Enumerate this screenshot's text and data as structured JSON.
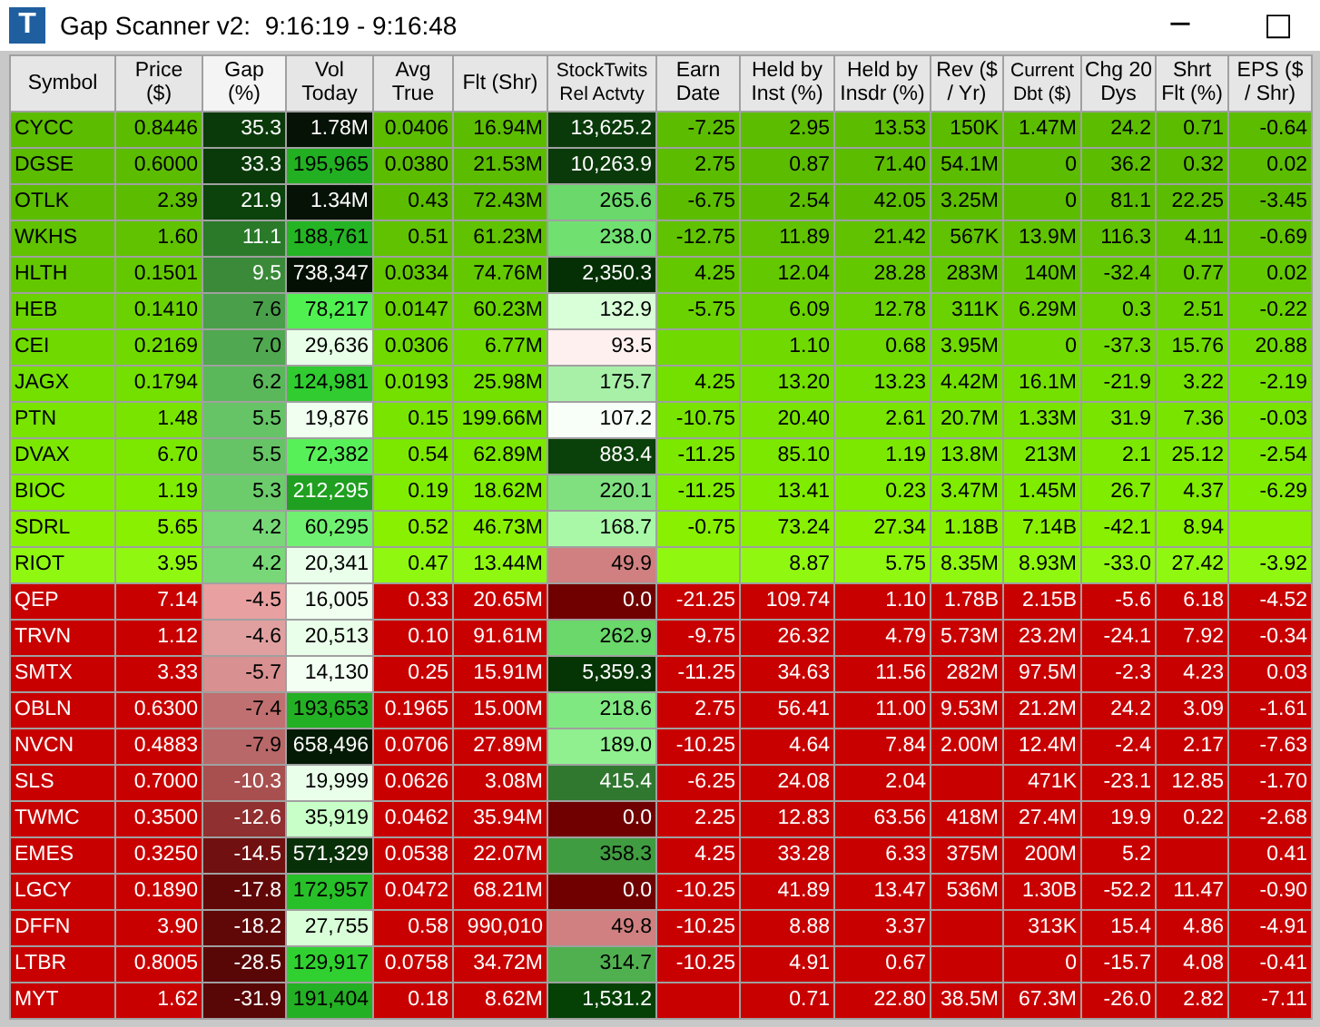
{
  "window": {
    "icon_letter": "T",
    "title": "Gap Scanner v2:  9:16:19 - 9:16:48",
    "controls": [
      "─",
      "□"
    ]
  },
  "table": {
    "columns": [
      {
        "label": "Symbol",
        "selected": false
      },
      {
        "label": "Price\n($)",
        "selected": false
      },
      {
        "label": "Gap\n(%)",
        "selected": true
      },
      {
        "label": "Vol\nToday",
        "selected": false
      },
      {
        "label": "Avg\nTrue",
        "selected": false
      },
      {
        "label": "Flt (Shr)",
        "selected": false
      },
      {
        "label": "StockTwits\nRel Actvty",
        "selected": false
      },
      {
        "label": "Earn\nDate",
        "selected": false
      },
      {
        "label": "Held by\nInst (%)",
        "selected": false
      },
      {
        "label": "Held by\nInsdr (%)",
        "selected": false
      },
      {
        "label": "Rev ($\n/ Yr)",
        "selected": false
      },
      {
        "label": "Current\nDbt ($)",
        "selected": false
      },
      {
        "label": "Chg 20\nDys",
        "selected": false
      },
      {
        "label": "Shrt\nFlt (%)",
        "selected": false
      },
      {
        "label": "EPS ($\n/ Shr)",
        "selected": false
      }
    ],
    "rows": [
      {
        "color": "#5cbc00",
        "cells": [
          "CYCC",
          "0.8446",
          {
            "text": "35.3",
            "color": "#0a3a0a"
          },
          {
            "text": "1.78M",
            "color": "#061206"
          },
          "0.0406",
          "16.94M",
          {
            "text": "13,625.2",
            "color": "#0a3a0a"
          },
          "-7.25",
          "2.95",
          "13.53",
          "150K",
          "1.47M",
          "24.2",
          "0.71",
          "-0.64"
        ]
      },
      {
        "color": "#5cbc00",
        "cells": [
          "DGSE",
          "0.6000",
          {
            "text": "33.3",
            "color": "#0a3a0a"
          },
          {
            "text": "195,965",
            "color": "#22b022"
          },
          "0.0380",
          "21.53M",
          {
            "text": "10,263.9",
            "color": "#0a3a0a"
          },
          "2.75",
          "0.87",
          "71.40",
          "54.1M",
          "0",
          "36.2",
          "0.32",
          "0.02"
        ]
      },
      {
        "color": "#5cbc00",
        "cells": [
          "OTLK",
          "2.39",
          {
            "text": "21.9",
            "color": "#0c420c"
          },
          {
            "text": "1.34M",
            "color": "#061206"
          },
          "0.43",
          "72.43M",
          {
            "text": "265.6",
            "color": "#6ad86a"
          },
          "-6.75",
          "2.54",
          "42.05",
          "3.25M",
          "0",
          "81.1",
          "22.25",
          "-3.45"
        ]
      },
      {
        "color": "#60c200",
        "cells": [
          "WKHS",
          "1.60",
          {
            "text": "11.1",
            "color": "#2a7a2a"
          },
          {
            "text": "188,761",
            "color": "#24b424"
          },
          "0.51",
          "61.23M",
          {
            "text": "238.0",
            "color": "#70e070"
          },
          "-12.75",
          "11.89",
          "21.42",
          "567K",
          "13.9M",
          "116.3",
          "4.11",
          "-0.69"
        ]
      },
      {
        "color": "#64c800",
        "cells": [
          "HLTH",
          "0.1501",
          {
            "text": "9.5",
            "color": "#3a8a3a"
          },
          {
            "text": "738,347",
            "color": "#051005"
          },
          "0.0334",
          "74.76M",
          {
            "text": "2,350.3",
            "color": "#053005"
          },
          "4.25",
          "12.04",
          "28.28",
          "283M",
          "140M",
          "-32.4",
          "0.77",
          "0.02"
        ]
      },
      {
        "color": "#6ad200",
        "cells": [
          "HEB",
          "0.1410",
          {
            "text": "7.6",
            "color": "#4aa04a"
          },
          {
            "text": "78,217",
            "color": "#50f050"
          },
          "0.0147",
          "60.23M",
          {
            "text": "132.9",
            "color": "#d8ffd8"
          },
          "-5.75",
          "6.09",
          "12.78",
          "311K",
          "6.29M",
          "0.3",
          "2.51",
          "-0.22"
        ]
      },
      {
        "color": "#70da00",
        "cells": [
          "CEI",
          "0.2169",
          {
            "text": "7.0",
            "color": "#50a850"
          },
          {
            "text": "29,636",
            "color": "#e8ffe8"
          },
          "0.0306",
          "6.77M",
          {
            "text": "93.5",
            "color": "#fff0f0"
          },
          null,
          "1.10",
          "0.68",
          "3.95M",
          "0",
          "-37.3",
          "15.76",
          "20.88"
        ]
      },
      {
        "color": "#74e000",
        "cells": [
          "JAGX",
          "0.1794",
          {
            "text": "6.2",
            "color": "#5ab85a"
          },
          {
            "text": "124,981",
            "color": "#30cc30"
          },
          "0.0193",
          "25.98M",
          {
            "text": "175.7",
            "color": "#a8f0a8"
          },
          "4.25",
          "13.20",
          "13.23",
          "4.42M",
          "16.1M",
          "-21.9",
          "3.22",
          "-2.19"
        ]
      },
      {
        "color": "#78e400",
        "cells": [
          "PTN",
          "1.48",
          {
            "text": "5.5",
            "color": "#66c466"
          },
          {
            "text": "19,876",
            "color": "#f0fff0"
          },
          "0.15",
          "199.66M",
          {
            "text": "107.2",
            "color": "#f8fff8"
          },
          "-10.75",
          "20.40",
          "2.61",
          "20.7M",
          "1.33M",
          "31.9",
          "7.36",
          "-0.03"
        ]
      },
      {
        "color": "#7ce800",
        "cells": [
          "DVAX",
          "6.70",
          {
            "text": "5.5",
            "color": "#66c466"
          },
          {
            "text": "72,382",
            "color": "#58f058"
          },
          "0.54",
          "62.89M",
          {
            "text": "883.4",
            "color": "#0a400a"
          },
          "-11.25",
          "85.10",
          "1.19",
          "13.8M",
          "213M",
          "2.1",
          "25.12",
          "-2.54"
        ]
      },
      {
        "color": "#80ec00",
        "cells": [
          "BIOC",
          "1.19",
          {
            "text": "5.3",
            "color": "#6ccc6c"
          },
          {
            "text": "212,295",
            "color": "#20a020"
          },
          "0.19",
          "18.62M",
          {
            "text": "220.1",
            "color": "#80e080"
          },
          "-11.25",
          "13.41",
          "0.23",
          "3.47M",
          "1.45M",
          "26.7",
          "4.37",
          "-6.29"
        ]
      },
      {
        "color": "#88f000",
        "cells": [
          "SDRL",
          "5.65",
          {
            "text": "4.2",
            "color": "#78d878"
          },
          {
            "text": "60,295",
            "color": "#70f070"
          },
          "0.52",
          "46.73M",
          {
            "text": "168.7",
            "color": "#a8f8a8"
          },
          "-0.75",
          "73.24",
          "27.34",
          "1.18B",
          "7.14B",
          "-42.1",
          "8.94",
          null
        ]
      },
      {
        "color": "#90f810",
        "cells": [
          "RIOT",
          "3.95",
          {
            "text": "4.2",
            "color": "#78d878"
          },
          {
            "text": "20,341",
            "color": "#eaffea"
          },
          "0.47",
          "13.44M",
          {
            "text": "49.9",
            "color": "#d08080"
          },
          null,
          "8.87",
          "5.75",
          "8.35M",
          "8.93M",
          "-33.0",
          "27.42",
          "-3.92"
        ]
      },
      {
        "color": "#c80000",
        "cells": [
          "QEP",
          "7.14",
          {
            "text": "-4.5",
            "color": "#e8a0a0"
          },
          {
            "text": "16,005",
            "color": "#f0fff0"
          },
          "0.33",
          "20.65M",
          {
            "text": "0.0",
            "color": "#700000"
          },
          "-21.25",
          "109.74",
          "1.10",
          "1.78B",
          "2.15B",
          "-5.6",
          "6.18",
          "-4.52"
        ]
      },
      {
        "color": "#c80000",
        "cells": [
          "TRVN",
          "1.12",
          {
            "text": "-4.6",
            "color": "#e0a0a0"
          },
          {
            "text": "20,513",
            "color": "#eaffea"
          },
          "0.10",
          "91.61M",
          {
            "text": "262.9",
            "color": "#6ad86a"
          },
          "-9.75",
          "26.32",
          "4.79",
          "5.73M",
          "23.2M",
          "-24.1",
          "7.92",
          "-0.34"
        ]
      },
      {
        "color": "#c80000",
        "cells": [
          "SMTX",
          "3.33",
          {
            "text": "-5.7",
            "color": "#d89090"
          },
          {
            "text": "14,130",
            "color": "#f2fff2"
          },
          "0.25",
          "15.91M",
          {
            "text": "5,359.3",
            "color": "#053505"
          },
          "-11.25",
          "34.63",
          "11.56",
          "282M",
          "97.5M",
          "-2.3",
          "4.23",
          "0.03"
        ]
      },
      {
        "color": "#c80000",
        "cells": [
          "OBLN",
          "0.6300",
          {
            "text": "-7.4",
            "color": "#c07070"
          },
          {
            "text": "193,653",
            "color": "#24b024"
          },
          "0.1965",
          "15.00M",
          {
            "text": "218.6",
            "color": "#80e880"
          },
          "2.75",
          "56.41",
          "11.00",
          "9.53M",
          "21.2M",
          "24.2",
          "3.09",
          "-1.61"
        ]
      },
      {
        "color": "#c80000",
        "cells": [
          "NVCN",
          "0.4883",
          {
            "text": "-7.9",
            "color": "#b86868"
          },
          {
            "text": "658,496",
            "color": "#051a05"
          },
          "0.0706",
          "27.89M",
          {
            "text": "189.0",
            "color": "#90f090"
          },
          "-10.25",
          "4.64",
          "7.84",
          "2.00M",
          "12.4M",
          "-2.4",
          "2.17",
          "-7.63"
        ]
      },
      {
        "color": "#c80000",
        "cells": [
          "SLS",
          "0.7000",
          {
            "text": "-10.3",
            "color": "#a85050"
          },
          {
            "text": "19,999",
            "color": "#eaffea"
          },
          "0.0626",
          "3.08M",
          {
            "text": "415.4",
            "color": "#307830"
          },
          "-6.25",
          "24.08",
          "2.04",
          null,
          "471K",
          "-23.1",
          "12.85",
          "-1.70"
        ]
      },
      {
        "color": "#c80000",
        "cells": [
          "TWMC",
          "0.3500",
          {
            "text": "-12.6",
            "color": "#903030"
          },
          {
            "text": "35,919",
            "color": "#c8ffc8"
          },
          "0.0462",
          "35.94M",
          {
            "text": "0.0",
            "color": "#700000"
          },
          "2.25",
          "12.83",
          "63.56",
          "418M",
          "27.4M",
          "19.9",
          "0.22",
          "-2.68"
        ]
      },
      {
        "color": "#c80000",
        "cells": [
          "EMES",
          "0.3250",
          {
            "text": "-14.5",
            "color": "#701010"
          },
          {
            "text": "571,329",
            "color": "#083008"
          },
          "0.0538",
          "22.07M",
          {
            "text": "358.3",
            "color": "#409c40"
          },
          "4.25",
          "33.28",
          "6.33",
          "375M",
          "200M",
          "5.2",
          null,
          "0.41"
        ]
      },
      {
        "color": "#c80000",
        "cells": [
          "LGCY",
          "0.1890",
          {
            "text": "-17.8",
            "color": "#600808"
          },
          {
            "text": "172,957",
            "color": "#28c028"
          },
          "0.0472",
          "68.21M",
          {
            "text": "0.0",
            "color": "#700000"
          },
          "-10.25",
          "41.89",
          "13.47",
          "536M",
          "1.30B",
          "-52.2",
          "11.47",
          "-0.90"
        ]
      },
      {
        "color": "#c80000",
        "cells": [
          "DFFN",
          "3.90",
          {
            "text": "-18.2",
            "color": "#600808"
          },
          {
            "text": "27,755",
            "color": "#d8ffd8"
          },
          "0.58",
          "990,010",
          {
            "text": "49.8",
            "color": "#d08080"
          },
          "-10.25",
          "8.88",
          "3.37",
          null,
          "313K",
          "15.4",
          "4.86",
          "-4.91"
        ]
      },
      {
        "color": "#c80000",
        "cells": [
          "LTBR",
          "0.8005",
          {
            "text": "-28.5",
            "color": "#580606"
          },
          {
            "text": "129,917",
            "color": "#30d030"
          },
          "0.0758",
          "34.72M",
          {
            "text": "314.7",
            "color": "#50b050"
          },
          "-10.25",
          "4.91",
          "0.67",
          null,
          "0",
          "-15.7",
          "4.08",
          "-0.41"
        ]
      },
      {
        "color": "#c80000",
        "cells": [
          "MYT",
          "1.62",
          {
            "text": "-31.9",
            "color": "#580606"
          },
          {
            "text": "191,404",
            "color": "#24b024"
          },
          "0.18",
          "8.62M",
          {
            "text": "1,531.2",
            "color": "#054005"
          },
          null,
          "0.71",
          "22.80",
          "38.5M",
          "67.3M",
          "-26.0",
          "2.82",
          "-7.11"
        ]
      }
    ]
  }
}
